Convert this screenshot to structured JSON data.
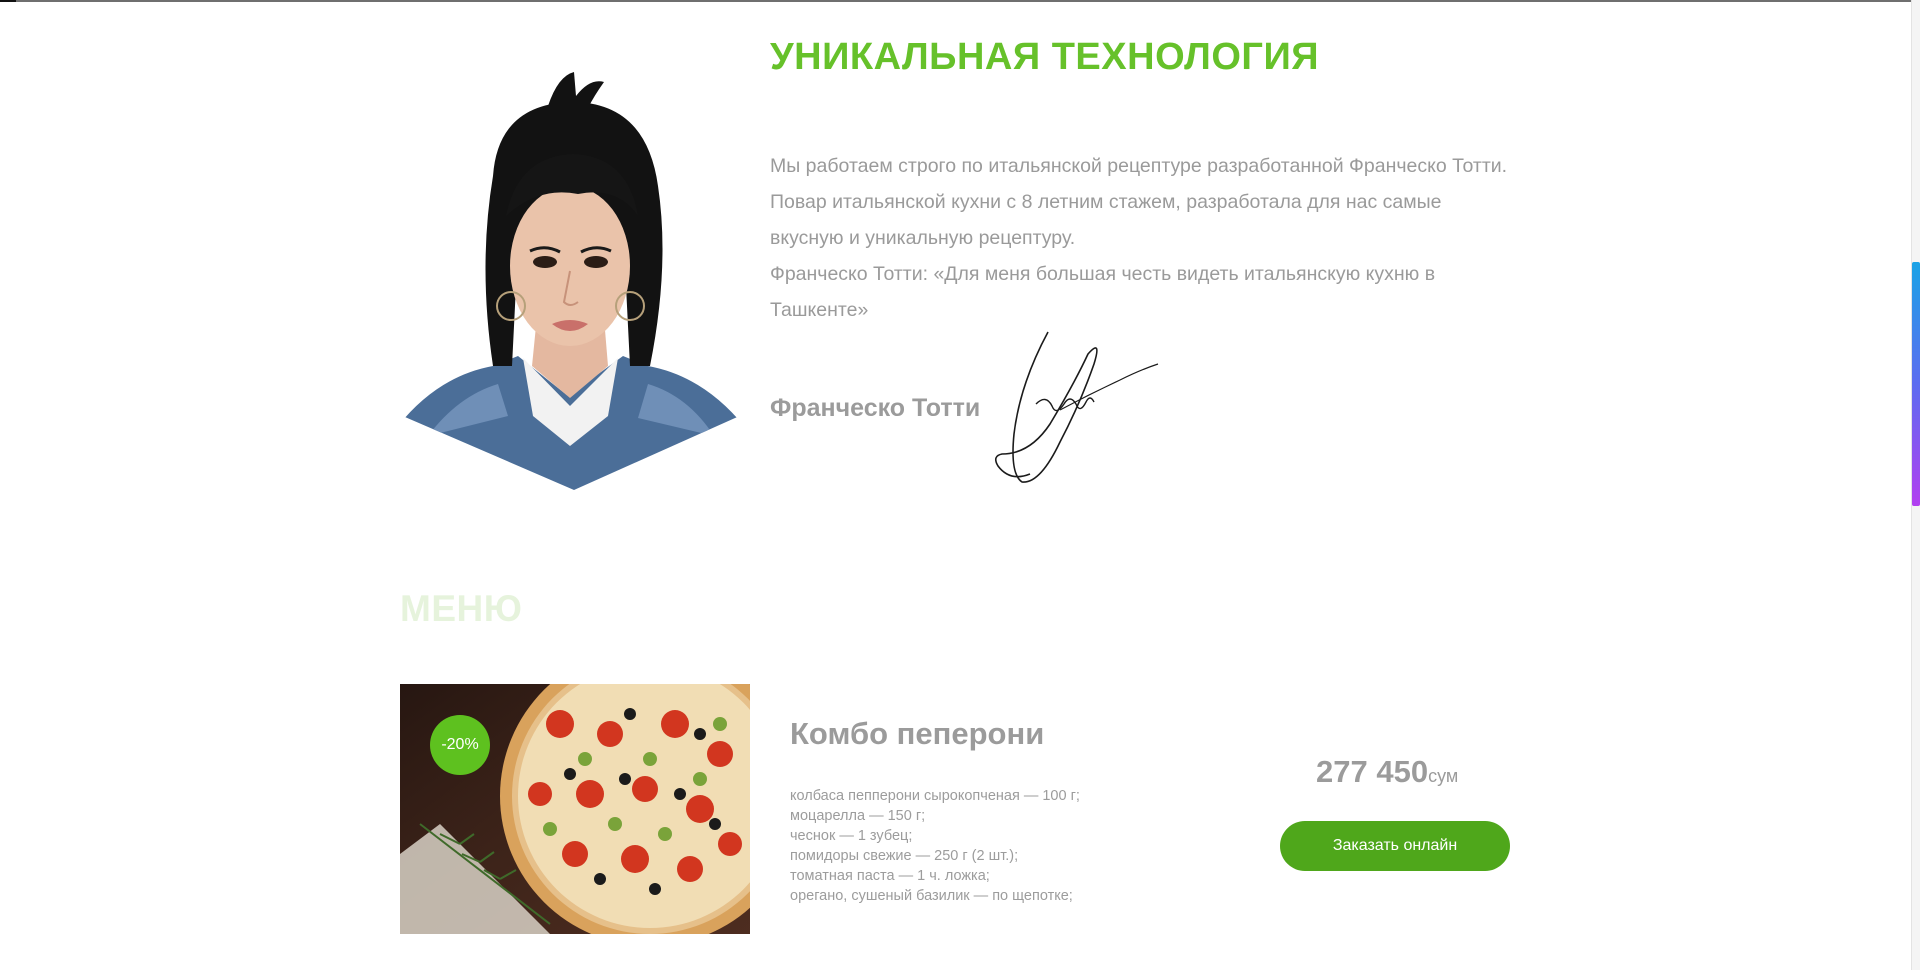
{
  "about": {
    "title": "УНИКАЛЬНАЯ ТЕХНОЛОГИЯ",
    "paragraph_1": "Мы работаем строго по итальянской рецептуре разработанной Франческо Тотти. Повар итальянской кухни с 8 летним стажем, разработала для нас самые вкусную и уникальную рецептуру.",
    "paragraph_2": "Франческо Тотти: «Для меня большая честь видеть итальянскую кухню в Ташкенте»",
    "author_name": "Франческо Тотти"
  },
  "menu": {
    "title": "МЕНЮ",
    "items": [
      {
        "discount": "-20%",
        "name": "Комбо пеперони",
        "ingredients": [
          "колбаса пепперони сырокопченая — 100 г;",
          "моцарелла — 150 г;",
          "чеснок — 1 зубец;",
          "помидоры свежие — 250 г (2 шт.);",
          "томатная паста — 1 ч. ложка;",
          "орегано, сушеный базилик — по щепотке;"
        ],
        "price": "277 450",
        "currency": "сум",
        "order_label": "Заказать онлайн"
      }
    ]
  },
  "colors": {
    "accent_green": "#66c12a",
    "button_green": "#4fa71b",
    "menu_title_faded": "#e6f3dc",
    "body_text_gray": "#9a9a9a"
  }
}
